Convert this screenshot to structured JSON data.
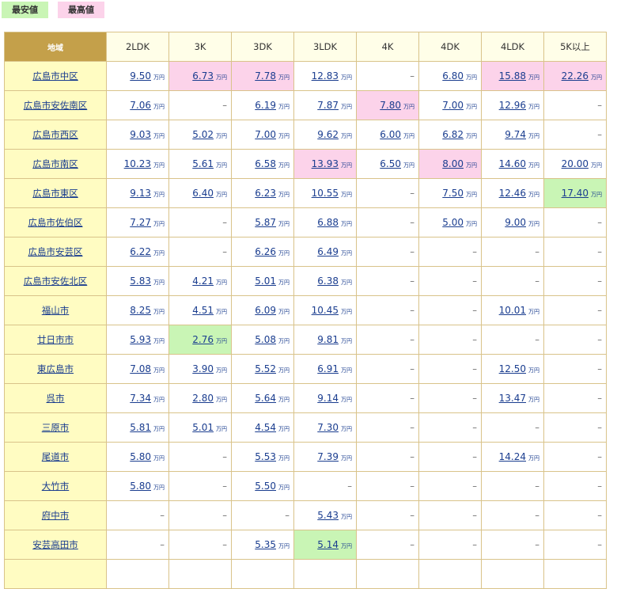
{
  "legend": {
    "low_label": "最安値",
    "high_label": "最高値",
    "low_color": "#c9f5b5",
    "high_color": "#fcd3ea"
  },
  "header": {
    "area": "地域",
    "cols": [
      "2LDK",
      "3K",
      "3DK",
      "3LDK",
      "4K",
      "4DK",
      "4LDK",
      "5K以上"
    ]
  },
  "unit": "万円",
  "dash": "–",
  "rows": [
    {
      "area": "広島市中区",
      "values": [
        "9.50",
        "6.73",
        "7.78",
        "12.83",
        null,
        "6.80",
        "15.88",
        "22.26"
      ],
      "high": [
        1,
        2,
        6,
        7
      ],
      "low": []
    },
    {
      "area": "広島市安佐南区",
      "values": [
        "7.06",
        null,
        "6.19",
        "7.87",
        "7.80",
        "7.00",
        "12.96",
        null
      ],
      "high": [
        4
      ],
      "low": []
    },
    {
      "area": "広島市西区",
      "values": [
        "9.03",
        "5.02",
        "7.00",
        "9.62",
        "6.00",
        "6.82",
        "9.74",
        null
      ],
      "high": [],
      "low": []
    },
    {
      "area": "広島市南区",
      "values": [
        "10.23",
        "5.61",
        "6.58",
        "13.93",
        "6.50",
        "8.00",
        "14.60",
        "20.00"
      ],
      "high": [
        3,
        5
      ],
      "low": []
    },
    {
      "area": "広島市東区",
      "values": [
        "9.13",
        "6.40",
        "6.23",
        "10.55",
        null,
        "7.50",
        "12.46",
        "17.40"
      ],
      "high": [],
      "low": [
        7
      ]
    },
    {
      "area": "広島市佐伯区",
      "values": [
        "7.27",
        null,
        "5.87",
        "6.88",
        null,
        "5.00",
        "9.00",
        null
      ],
      "high": [],
      "low": []
    },
    {
      "area": "広島市安芸区",
      "values": [
        "6.22",
        null,
        "6.26",
        "6.49",
        null,
        null,
        null,
        null
      ],
      "high": [],
      "low": []
    },
    {
      "area": "広島市安佐北区",
      "values": [
        "5.83",
        "4.21",
        "5.01",
        "6.38",
        null,
        null,
        null,
        null
      ],
      "high": [],
      "low": []
    },
    {
      "area": "福山市",
      "values": [
        "8.25",
        "4.51",
        "6.09",
        "10.45",
        null,
        null,
        "10.01",
        null
      ],
      "high": [],
      "low": []
    },
    {
      "area": "廿日市市",
      "values": [
        "5.93",
        "2.76",
        "5.08",
        "9.81",
        null,
        null,
        null,
        null
      ],
      "high": [],
      "low": [
        1
      ]
    },
    {
      "area": "東広島市",
      "values": [
        "7.08",
        "3.90",
        "5.52",
        "6.91",
        null,
        null,
        "12.50",
        null
      ],
      "high": [],
      "low": []
    },
    {
      "area": "呉市",
      "values": [
        "7.34",
        "2.80",
        "5.64",
        "9.14",
        null,
        null,
        "13.47",
        null
      ],
      "high": [],
      "low": []
    },
    {
      "area": "三原市",
      "values": [
        "5.81",
        "5.01",
        "4.54",
        "7.30",
        null,
        null,
        null,
        null
      ],
      "high": [],
      "low": []
    },
    {
      "area": "尾道市",
      "values": [
        "5.80",
        null,
        "5.53",
        "7.39",
        null,
        null,
        "14.24",
        null
      ],
      "high": [],
      "low": []
    },
    {
      "area": "大竹市",
      "values": [
        "5.80",
        null,
        "5.50",
        null,
        null,
        null,
        null,
        null
      ],
      "high": [],
      "low": []
    },
    {
      "area": "府中市",
      "values": [
        null,
        null,
        null,
        "5.43",
        null,
        null,
        null,
        null
      ],
      "high": [],
      "low": []
    },
    {
      "area": "安芸高田市",
      "values": [
        null,
        null,
        "5.35",
        "5.14",
        null,
        null,
        null,
        null
      ],
      "high": [],
      "low": [
        3
      ]
    },
    {
      "area": "",
      "values": [
        null,
        null,
        null,
        null,
        null,
        null,
        null,
        null
      ],
      "high": [],
      "low": []
    }
  ]
}
